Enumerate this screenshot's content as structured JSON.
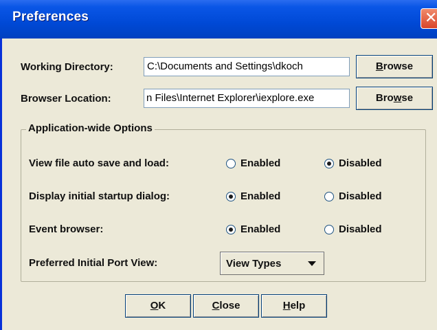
{
  "window": {
    "title": "Preferences",
    "close_glyph": "✕"
  },
  "fields": {
    "working_directory": {
      "label": "Working Directory:",
      "value": "C:\\Documents and Settings\\dkoch"
    },
    "browser_location": {
      "label": "Browser Location:",
      "value": "n Files\\Internet Explorer\\iexplore.exe"
    }
  },
  "browse_button": {
    "prefix": "",
    "mnemonic": "B",
    "suffix": "rowse"
  },
  "browse_button_2": {
    "prefix": "Bro",
    "mnemonic": "w",
    "suffix": "se"
  },
  "options": {
    "group_title": "Application-wide Options",
    "rows": [
      {
        "label": "View file auto save and load:",
        "enabled_label": "Enabled",
        "disabled_label": "Disabled",
        "selected": "Disabled"
      },
      {
        "label": "Display initial startup dialog:",
        "enabled_label": "Enabled",
        "disabled_label": "Disabled",
        "selected": "Enabled"
      },
      {
        "label": "Event browser:",
        "enabled_label": "Enabled",
        "disabled_label": "Disabled",
        "selected": "Enabled"
      }
    ],
    "port_view": {
      "label": "Preferred Initial Port View:",
      "selected": "View Types"
    }
  },
  "footer": {
    "ok": {
      "prefix": "",
      "mnemonic": "O",
      "suffix": "K"
    },
    "close": {
      "prefix": "",
      "mnemonic": "C",
      "suffix": "lose"
    },
    "help": {
      "prefix": "",
      "mnemonic": "H",
      "suffix": "elp"
    }
  }
}
